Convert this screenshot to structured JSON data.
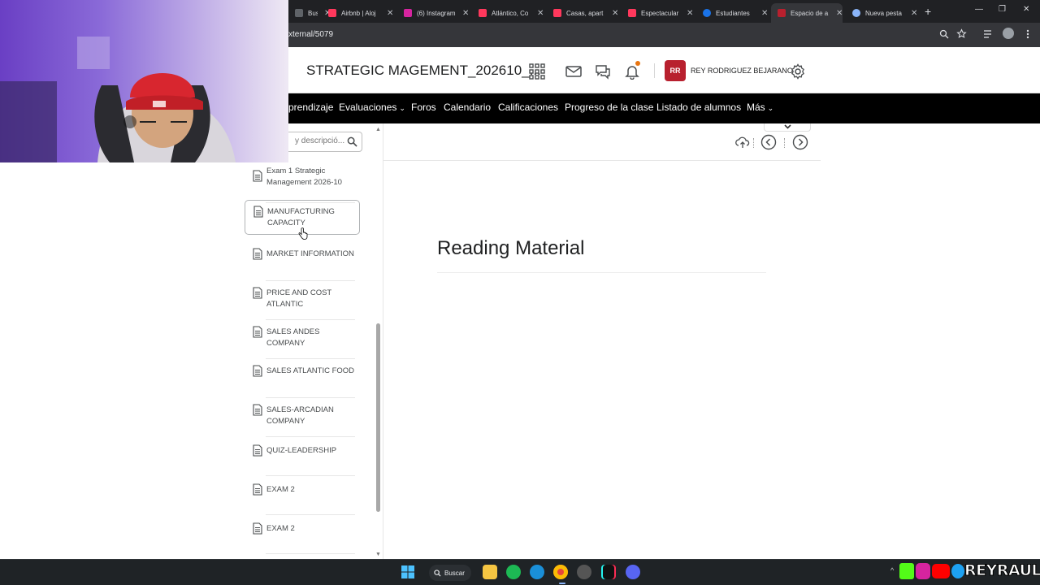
{
  "browser": {
    "tabs": [
      {
        "label": "Busi",
        "color": "#5f6368"
      },
      {
        "label": "Airbnb | Aloj",
        "color": "#ff385c"
      },
      {
        "label": "(6) Instagram",
        "color": "#d6249f"
      },
      {
        "label": "Atlántico, Co",
        "color": "#ff385c"
      },
      {
        "label": "Casas, apart",
        "color": "#ff385c"
      },
      {
        "label": "Espectacular",
        "color": "#ff385c"
      },
      {
        "label": "Estudiantes",
        "color": "#1a73e8"
      },
      {
        "label": "Espacio de a",
        "color": "#b8202e"
      },
      {
        "label": "Nueva pesta",
        "color": "#8ab4f8"
      }
    ],
    "url": "xternal/5079"
  },
  "header": {
    "course_title": "STRATEGIC MAGEMENT_202610_...",
    "avatar_initials": "RR",
    "username": "REY RODRIGUEZ BEJARANO",
    "icons": [
      "apps-grid-icon",
      "mail-icon",
      "chat-icon",
      "bell-icon",
      "gear-icon"
    ]
  },
  "nav": {
    "items": [
      {
        "label": "prendizaje"
      },
      {
        "label": "Evaluaciones",
        "dropdown": true
      },
      {
        "label": "Foros"
      },
      {
        "label": "Calendario"
      },
      {
        "label": "Calificaciones"
      },
      {
        "label": "Progreso de la clase"
      },
      {
        "label": "Listado de alumnos"
      },
      {
        "label": "Más",
        "dropdown": true
      }
    ],
    "chevron": "⌄"
  },
  "sidebar": {
    "search_placeholder": "y descripció...",
    "items": [
      {
        "label": "Exam 1 Strategic Management 2026-10"
      },
      {
        "label": "MANUFACTURING CAPACITY",
        "selected": true
      },
      {
        "label": "MARKET INFORMATION"
      },
      {
        "label": "PRICE AND COST ATLANTIC"
      },
      {
        "label": "SALES ANDES COMPANY"
      },
      {
        "label": "SALES ATLANTIC FOOD"
      },
      {
        "label": "SALES-ARCADIAN COMPANY"
      },
      {
        "label": "QUIZ-LEADERSHIP"
      },
      {
        "label": "EXAM 2"
      },
      {
        "label": "EXAM 2"
      }
    ]
  },
  "content": {
    "heading": "Reading Material"
  },
  "taskbar": {
    "search_label": "Buscar",
    "brand": "REYRAUL"
  },
  "colors": {
    "accent_red": "#b8202e",
    "navbar_bg": "#000000",
    "notification_dot": "#e87511"
  }
}
